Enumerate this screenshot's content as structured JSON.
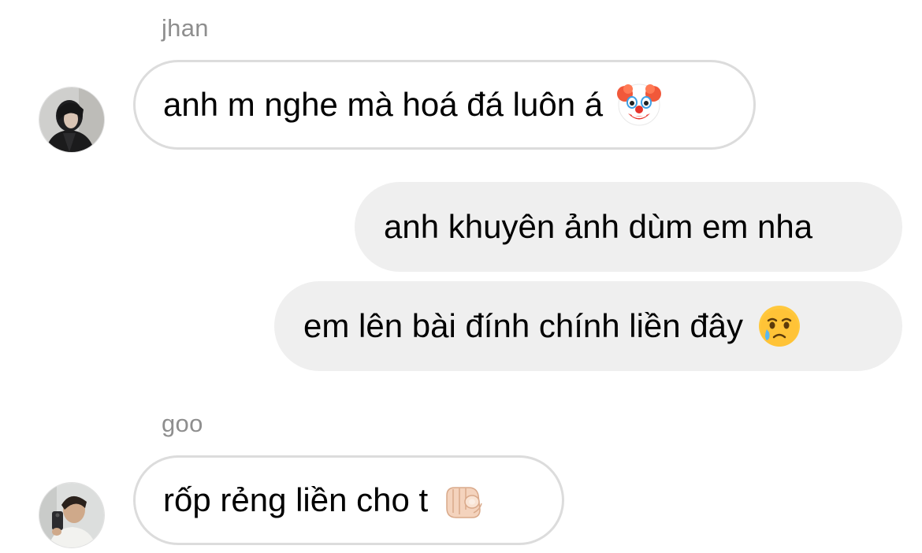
{
  "conversation": {
    "messages": [
      {
        "direction": "incoming",
        "sender": "jhan",
        "text": "anh m nghe mà hoá đá luôn á",
        "emoji": "clown-face"
      },
      {
        "direction": "outgoing",
        "text": "anh khuyên ảnh dùm em nha"
      },
      {
        "direction": "outgoing",
        "text": "em lên bài đính chính liền đây",
        "emoji": "face-holding-back-tears"
      },
      {
        "direction": "incoming",
        "sender": "goo",
        "text": "rốp rẻng liền cho t",
        "emoji": "index-pointing-at-viewer-light-skin"
      }
    ]
  },
  "colors": {
    "incoming_bubble_bg": "#ffffff",
    "incoming_bubble_border": "#dcdcdc",
    "outgoing_bubble_bg": "#efefef",
    "sender_name": "#8e8e8e",
    "text": "#000000"
  }
}
